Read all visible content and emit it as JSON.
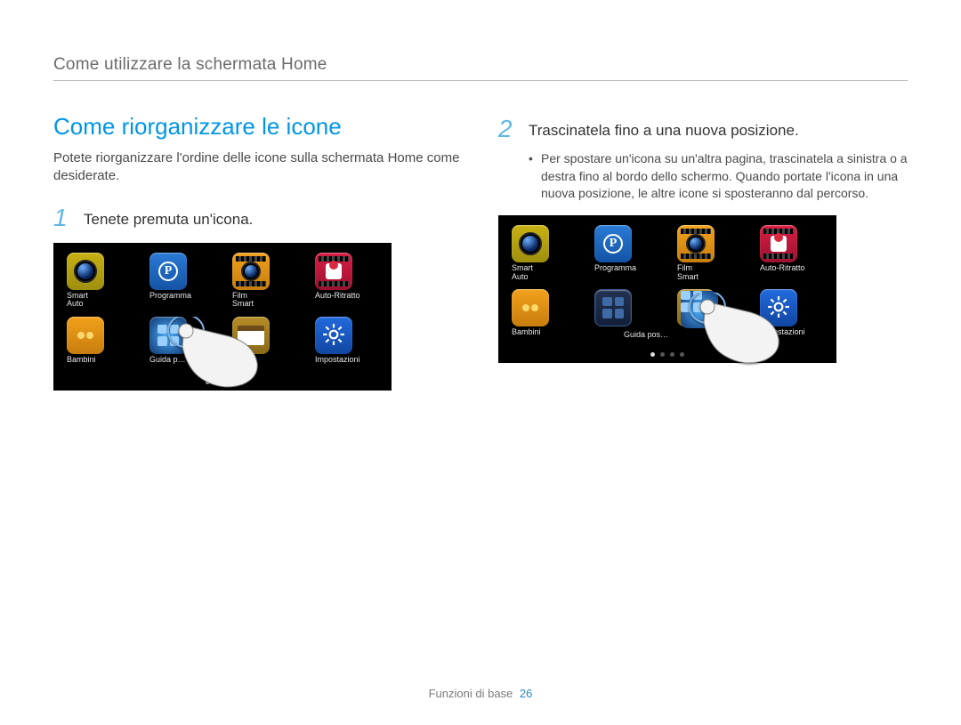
{
  "header": {
    "breadcrumb": "Come utilizzare la schermata Home"
  },
  "section": {
    "title": "Come riorganizzare le icone",
    "intro": "Potete riorganizzare l'ordine delle icone sulla schermata Home come desiderate."
  },
  "step1": {
    "num": "1",
    "text": "Tenete premuta un'icona."
  },
  "step2": {
    "num": "2",
    "text": "Trascinatela fino a una nuova posizione.",
    "bullet": "Per spostare un'icona su un'altra pagina, trascinatela a sinistra o a destra fino al bordo dello schermo. Quando portate l'icona in una nuova posizione, le altre icone si sposteranno dal percorso."
  },
  "screenshot1": {
    "apps": [
      {
        "name": "smart-auto",
        "label": "Smart\nAuto",
        "tile": "olive",
        "icon": "camera"
      },
      {
        "name": "programma",
        "label": "Programma",
        "tile": "blue",
        "icon": "p"
      },
      {
        "name": "film-smart",
        "label": "Film\nSmart",
        "tile": "orange",
        "icon": "film"
      },
      {
        "name": "auto-ritratto",
        "label": "Auto-Ritratto",
        "tile": "red",
        "icon": "portrait"
      },
      {
        "name": "bambini",
        "label": "Bambini",
        "tile": "orange",
        "icon": "kids"
      },
      {
        "name": "guida-pos",
        "label": "Guida p…",
        "tile": "cyan",
        "icon": "guide"
      },
      {
        "name": "album",
        "label": "Album",
        "tile": "gold",
        "icon": "album"
      },
      {
        "name": "impostazioni",
        "label": "Impostazioni",
        "tile": "blue2",
        "icon": "gear"
      }
    ]
  },
  "screenshot2": {
    "apps": [
      {
        "name": "smart-auto",
        "label": "Smart\nAuto",
        "tile": "olive",
        "icon": "camera"
      },
      {
        "name": "programma",
        "label": "Programma",
        "tile": "blue",
        "icon": "p"
      },
      {
        "name": "film-smart",
        "label": "Film\nSmart",
        "tile": "orange",
        "icon": "film"
      },
      {
        "name": "auto-ritratto",
        "label": "Auto-Ritratto",
        "tile": "red",
        "icon": "portrait"
      },
      {
        "name": "bambini",
        "label": "Bambini",
        "tile": "orange",
        "icon": "kids"
      },
      {
        "name": "empty",
        "label": "",
        "tile": "empty",
        "icon": "empty"
      },
      {
        "name": "album",
        "label": "",
        "tile": "gold",
        "icon": "album"
      },
      {
        "name": "impostazioni",
        "label": "Impostazioni",
        "tile": "blue2",
        "icon": "gear"
      }
    ],
    "drag_label": "Guida pos…"
  },
  "footer": {
    "section": "Funzioni di base",
    "page": "26"
  }
}
